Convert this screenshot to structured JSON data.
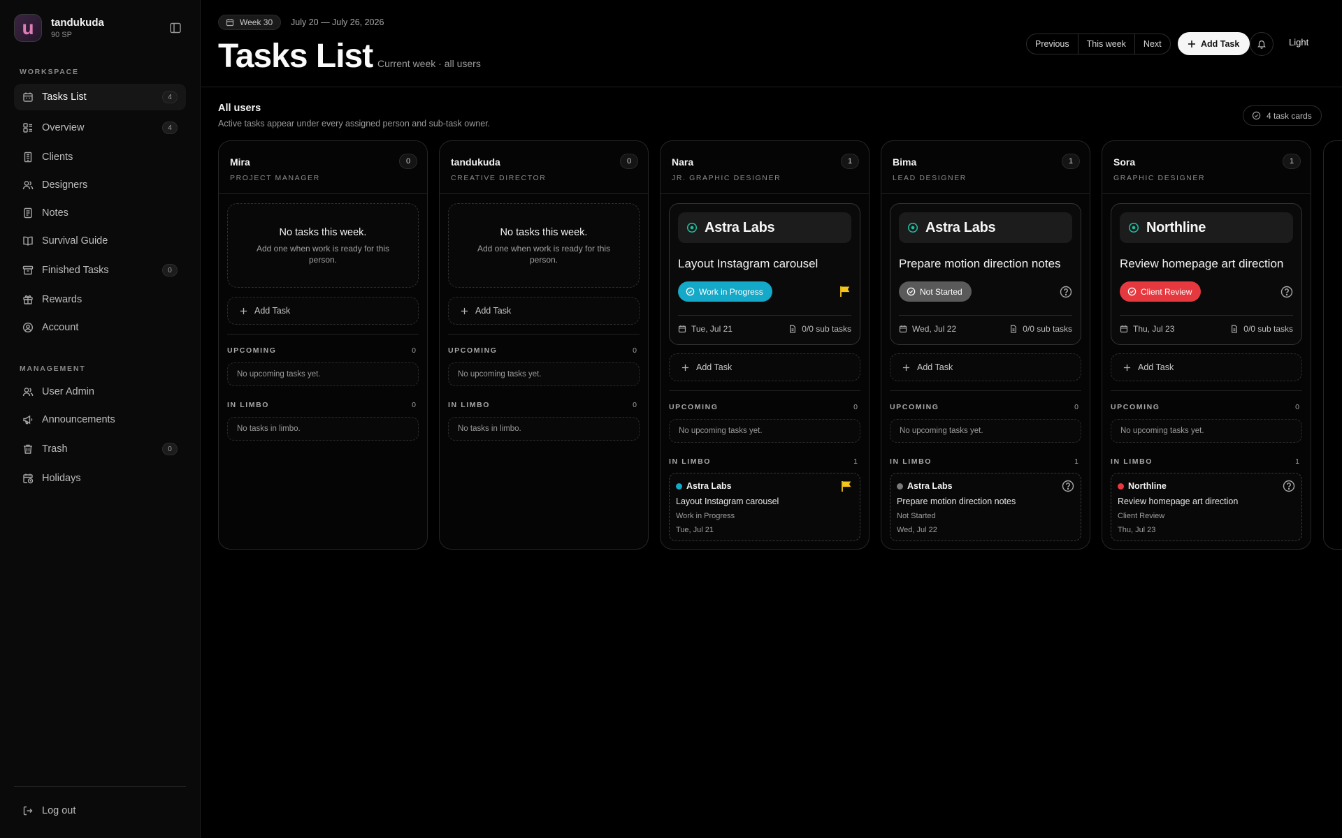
{
  "user": {
    "initial": "u",
    "name": "tandukuda",
    "points": "90 SP"
  },
  "sidebar": {
    "workspace_label": "WORKSPACE",
    "management_label": "MANAGEMENT",
    "workspace_items": [
      {
        "label": "Tasks List",
        "count": "4",
        "icon": "calendar-icon"
      },
      {
        "label": "Overview",
        "count": "4",
        "icon": "dashboard-icon"
      },
      {
        "label": "Clients",
        "count": "",
        "icon": "layers-icon"
      },
      {
        "label": "Designers",
        "count": "",
        "icon": "users-icon"
      },
      {
        "label": "Notes",
        "count": "",
        "icon": "note-icon"
      },
      {
        "label": "Survival Guide",
        "count": "",
        "icon": "book-icon"
      },
      {
        "label": "Finished Tasks",
        "count": "0",
        "icon": "archive-icon"
      },
      {
        "label": "Rewards",
        "count": "",
        "icon": "gift-icon"
      },
      {
        "label": "Account",
        "count": "",
        "icon": "user-circle-icon"
      }
    ],
    "management_items": [
      {
        "label": "User Admin",
        "count": "",
        "icon": "users-icon"
      },
      {
        "label": "Announcements",
        "count": "",
        "icon": "megaphone-icon"
      },
      {
        "label": "Trash",
        "count": "0",
        "icon": "trash-icon"
      },
      {
        "label": "Holidays",
        "count": "",
        "icon": "calendar-clock-icon"
      }
    ],
    "logout_label": "Log out"
  },
  "header": {
    "week_badge": "Week 30",
    "week_range": "July 20 — July 26, 2026",
    "title": "Tasks List",
    "subtitle": "Current week · all users",
    "nav": {
      "previous": "Previous",
      "this_week": "This week",
      "next": "Next"
    },
    "add_task": "Add Task",
    "theme": "Light"
  },
  "content": {
    "title": "All users",
    "description": "Active tasks appear under every assigned person and sub-task owner.",
    "card_count": "4 task cards",
    "add_task_label": "Add Task",
    "upcoming_label": "UPCOMING",
    "limbo_label": "IN LIMBO",
    "no_upcoming": "No upcoming tasks yet.",
    "no_limbo": "No tasks in limbo.",
    "empty_title": "No tasks this week.",
    "empty_desc": "Add one when work is ready for this person."
  },
  "colors": {
    "work_in_progress": "#14a9c9",
    "not_started": "#5a5a5a",
    "client_review": "#e5393f",
    "client_icon": "#1fbfa1",
    "flag": "#f5c518"
  },
  "columns": [
    {
      "name": "Mira",
      "role": "PROJECT MANAGER",
      "count": "0",
      "upcoming_count": "0",
      "limbo_count": "0"
    },
    {
      "name": "tandukuda",
      "role": "CREATIVE DIRECTOR",
      "count": "0",
      "upcoming_count": "0",
      "limbo_count": "0"
    },
    {
      "name": "Nara",
      "role": "JR. GRAPHIC DESIGNER",
      "count": "1",
      "upcoming_count": "0",
      "limbo_count": "1",
      "task": {
        "client": "Astra Labs",
        "title": "Layout Instagram carousel",
        "status": "Work in Progress",
        "date": "Tue, Jul 21",
        "subtasks": "0/0 sub tasks",
        "marker": "flag-icon"
      }
    },
    {
      "name": "Bima",
      "role": "LEAD DESIGNER",
      "count": "1",
      "upcoming_count": "0",
      "limbo_count": "1",
      "task": {
        "client": "Astra Labs",
        "title": "Prepare motion direction notes",
        "status": "Not Started",
        "date": "Wed, Jul 22",
        "subtasks": "0/0 sub tasks",
        "marker": "help-icon"
      }
    },
    {
      "name": "Sora",
      "role": "GRAPHIC DESIGNER",
      "count": "1",
      "upcoming_count": "0",
      "limbo_count": "1",
      "task": {
        "client": "Northline",
        "title": "Review homepage art direction",
        "status": "Client Review",
        "date": "Thu, Jul 23",
        "subtasks": "0/0 sub tasks",
        "marker": "help-icon"
      }
    }
  ]
}
